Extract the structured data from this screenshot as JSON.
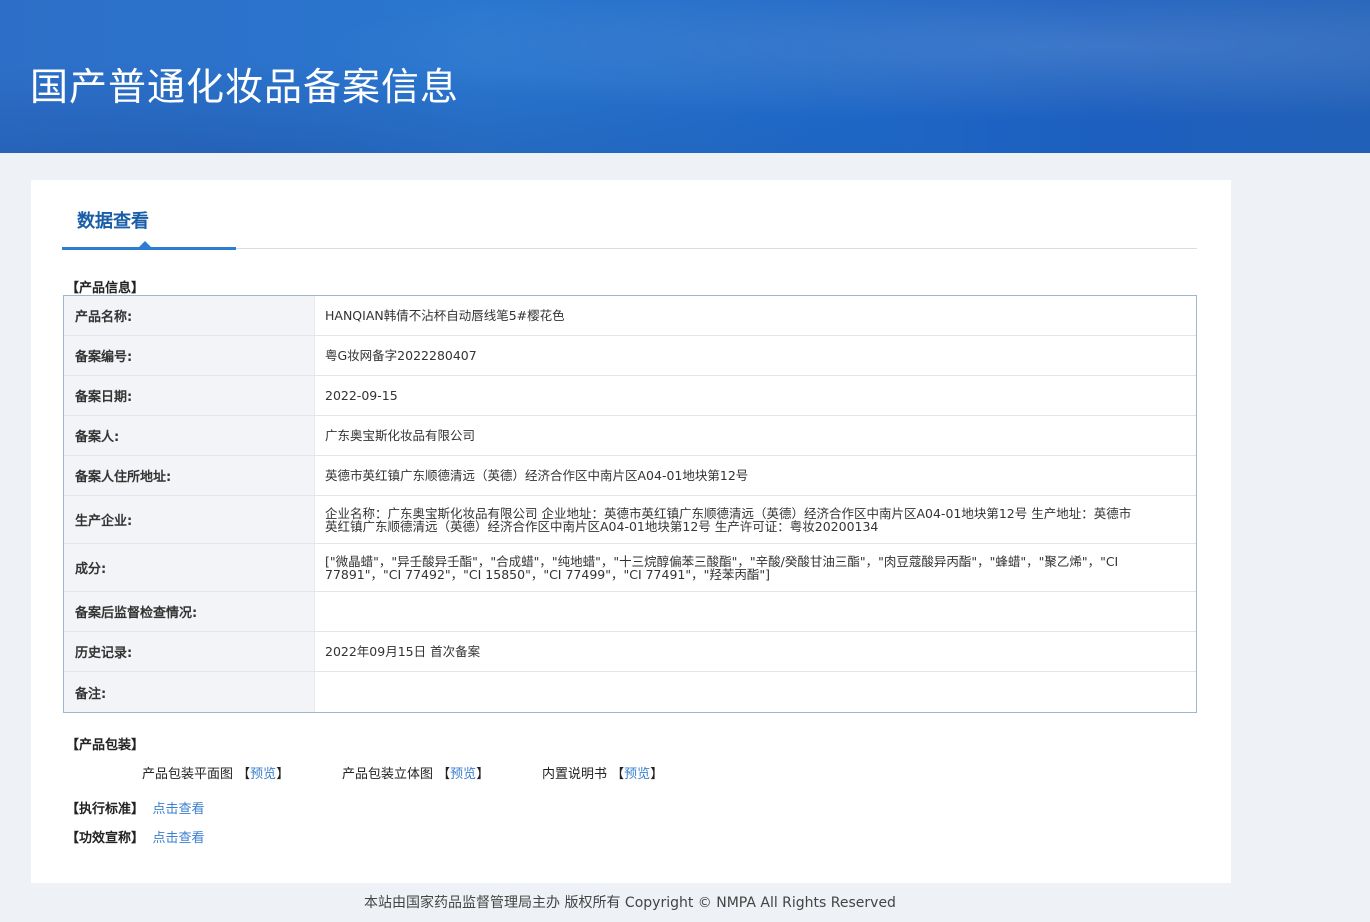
{
  "header": {
    "title": "国产普通化妆品备案信息"
  },
  "tab": {
    "label": "数据查看"
  },
  "product_info": {
    "section_title": "【产品信息】",
    "rows": [
      {
        "label": "产品名称:",
        "value": "HANQIAN韩倩不沾杯自动唇线笔5#樱花色"
      },
      {
        "label": "备案编号:",
        "value": "粤G妆网备字2022280407"
      },
      {
        "label": "备案日期:",
        "value": "2022-09-15"
      },
      {
        "label": "备案人:",
        "value": "广东奥宝斯化妆品有限公司"
      },
      {
        "label": "备案人住所地址:",
        "value": "英德市英红镇广东顺德清远（英德）经济合作区中南片区A04-01地块第12号"
      },
      {
        "label": "生产企业:",
        "value": "企业名称：广东奥宝斯化妆品有限公司 企业地址：英德市英红镇广东顺德清远（英德）经济合作区中南片区A04-01地块第12号 生产地址：英德市英红镇广东顺德清远（英德）经济合作区中南片区A04-01地块第12号 生产许可证：粤妆20200134"
      },
      {
        "label": "成分:",
        "value": "[\"微晶蜡\"，\"异壬酸异壬酯\"，\"合成蜡\"，\"纯地蜡\"，\"十三烷醇偏苯三酸酯\"，\"辛酸/癸酸甘油三酯\"，\"肉豆蔻酸异丙酯\"，\"蜂蜡\"，\"聚乙烯\"，\"CI 77891\"，\"CI 77492\"，\"CI 15850\"，\"CI 77499\"，\"CI 77491\"，\"羟苯丙酯\"]"
      },
      {
        "label": "备案后监督检查情况:",
        "value": ""
      },
      {
        "label": "历史记录:",
        "value": "2022年09月15日 首次备案"
      },
      {
        "label": "备注:",
        "value": ""
      }
    ]
  },
  "packaging": {
    "section_title": "【产品包装】",
    "items": [
      {
        "label": "产品包装平面图",
        "bracket_open": "【",
        "link": "预览",
        "bracket_close": "】"
      },
      {
        "label": "产品包装立体图",
        "bracket_open": "【",
        "link": "预览",
        "bracket_close": "】"
      },
      {
        "label": "内置说明书",
        "bracket_open": "【",
        "link": "预览",
        "bracket_close": "】"
      }
    ]
  },
  "standard": {
    "title": "【执行标准】",
    "link": "点击查看"
  },
  "efficacy": {
    "title": "【功效宣称】",
    "link": "点击查看"
  },
  "footer": {
    "text": "本站由国家药品监督管理局主办 版权所有 Copyright © NMPA All Rights Reserved"
  }
}
